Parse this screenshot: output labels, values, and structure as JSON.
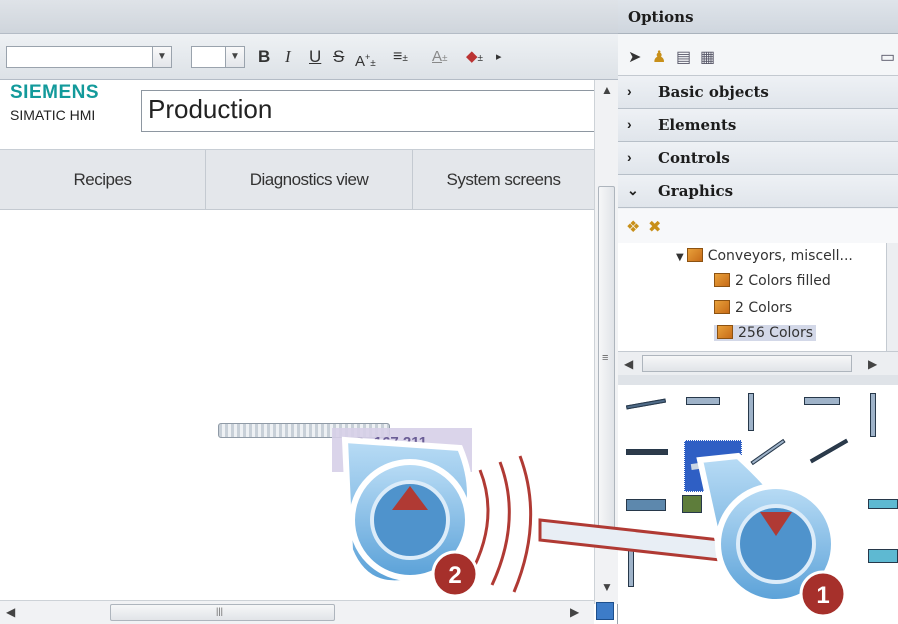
{
  "editor": {
    "logo_brand": "SIEMENS",
    "logo_sub": "SIMATIC HMI",
    "screen_title": "Production",
    "nav": [
      "Recipes",
      "Diagnostics view",
      "System screens"
    ],
    "tooltip": "↗: 167,211",
    "toolbar": {
      "bold": "B",
      "italic": "I",
      "underline": "U",
      "strike": "S"
    }
  },
  "options": {
    "title": "Options",
    "sections": [
      {
        "label": "Basic objects",
        "expanded": false
      },
      {
        "label": "Elements",
        "expanded": false
      },
      {
        "label": "Controls",
        "expanded": false
      },
      {
        "label": "Graphics",
        "expanded": true
      }
    ],
    "tree": {
      "root": "Conveyors, miscell...",
      "children": [
        "2 Colors filled",
        "2 Colors",
        "256 Colors"
      ],
      "selected": "256 Colors"
    }
  },
  "callouts": {
    "step1": "1",
    "step2": "2"
  },
  "colors": {
    "siemens_teal": "#139a9b",
    "callout_blue": "#7fb7e0",
    "callout_badge": "#a6302b"
  }
}
